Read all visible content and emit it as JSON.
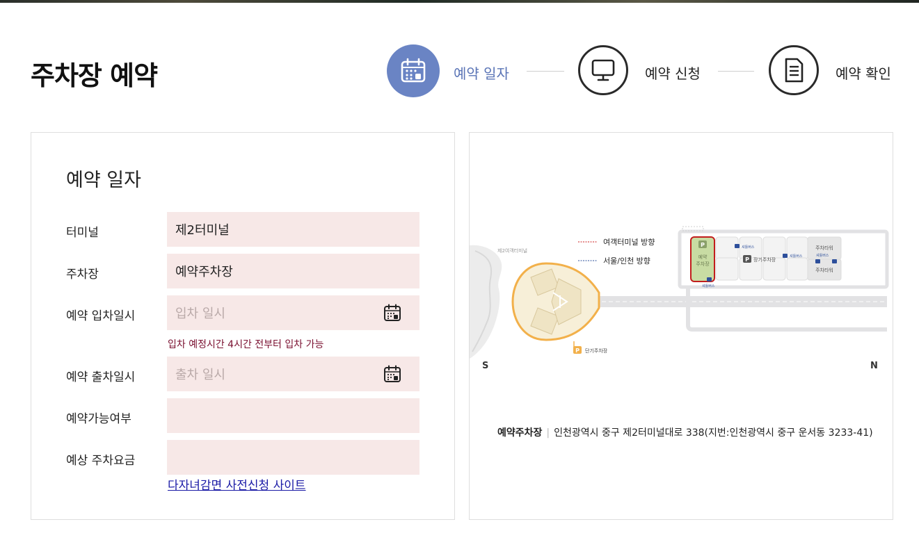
{
  "page": {
    "title": "주차장 예약"
  },
  "steps": [
    {
      "label": "예약 일자",
      "icon": "calendar-icon",
      "active": true
    },
    {
      "label": "예약 신청",
      "icon": "monitor-icon",
      "active": false
    },
    {
      "label": "예약 확인",
      "icon": "document-icon",
      "active": false
    }
  ],
  "form": {
    "title": "예약 일자",
    "terminal": {
      "label": "터미널",
      "value": "제2터미널"
    },
    "parking": {
      "label": "주차장",
      "value": "예약주차장"
    },
    "entry": {
      "label": "예약 입차일시",
      "placeholder": "입차 일시"
    },
    "entry_hint": "입차 예정시간 4시간 전부터 입차 가능",
    "exit": {
      "label": "예약 출차일시",
      "placeholder": "출차 일시"
    },
    "availability": {
      "label": "예약가능여부",
      "value": ""
    },
    "fee": {
      "label": "예상 주차요금",
      "value": ""
    },
    "link": "다자녀감면 사전신청 사이트"
  },
  "map": {
    "legend_terminal": "여객터미널 방향",
    "legend_seoul": "서울/인천 방향",
    "terminal_label": "제2여객터미널",
    "reserve_lot": [
      "예약",
      "주차장"
    ],
    "long_term": "장기주차장",
    "short_term": "단기주차장",
    "tower_top": "주차타워",
    "tower_bottom": "주차타워",
    "bus_label": "셔틀버스",
    "p_letter": "P",
    "south": "S",
    "north": "N",
    "colors": {
      "terminal_line": "#cc1f1f",
      "seoul_line": "#2d4f9b",
      "terminal_ring": "#f2b04a",
      "reserve_lot_border": "#c21d1d"
    }
  },
  "address": {
    "name": "예약주차장",
    "separator": "|",
    "text": "인천광역시 중구 제2터미널대로 338(지번:인천광역시 중구 운서동 3233-41)"
  }
}
